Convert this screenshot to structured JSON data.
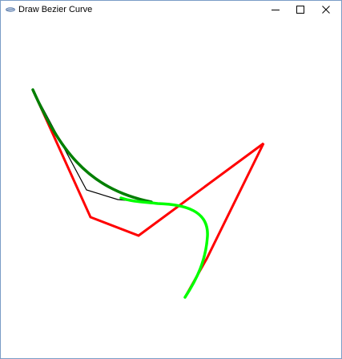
{
  "window": {
    "title": "Draw Bezier Curve",
    "app_icon": "feather-pen-icon",
    "controls": {
      "minimize_icon": "minimize-icon",
      "maximize_icon": "maximize-icon",
      "close_icon": "close-icon"
    }
  },
  "canvas": {
    "background_color": "#ffffff",
    "control_polygon_color": "#ff0000",
    "curve_color": "#00ff00",
    "curve_dark_color": "#007f00",
    "construction_line_color": "#000000"
  }
}
